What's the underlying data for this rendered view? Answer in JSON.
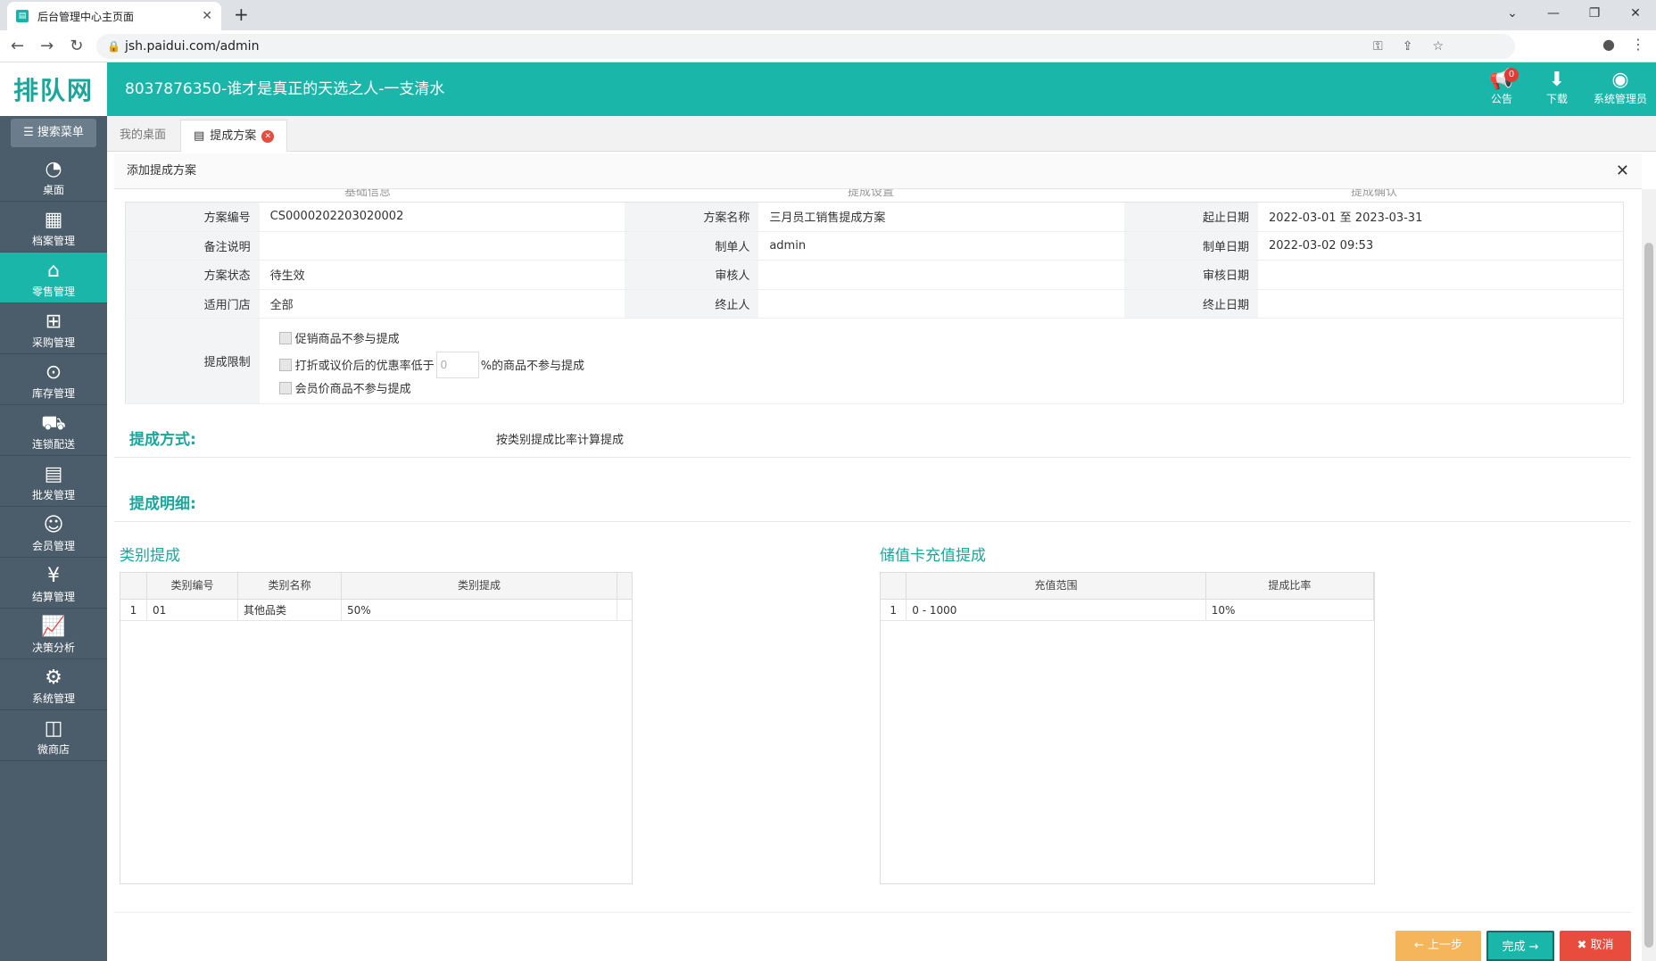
{
  "browser": {
    "tab_title": "后台管理中心主页面",
    "url": "jsh.paidui.com/admin"
  },
  "header": {
    "logo": "排队网",
    "title": "8037876350-谁才是真正的天选之人-一支清水",
    "notice_label": "公告",
    "notice_count": "0",
    "download_label": "下载",
    "user_label": "系统管理员"
  },
  "sidebar": {
    "search_label": "搜索菜单",
    "items": [
      {
        "label": "桌面",
        "icon": "dashboard-icon"
      },
      {
        "label": "档案管理",
        "icon": "archive-icon"
      },
      {
        "label": "零售管理",
        "icon": "store-icon"
      },
      {
        "label": "采购管理",
        "icon": "cart-icon"
      },
      {
        "label": "库存管理",
        "icon": "inventory-icon"
      },
      {
        "label": "连锁配送",
        "icon": "truck-icon"
      },
      {
        "label": "批发管理",
        "icon": "wholesale-icon"
      },
      {
        "label": "会员管理",
        "icon": "member-icon"
      },
      {
        "label": "结算管理",
        "icon": "settle-icon"
      },
      {
        "label": "决策分析",
        "icon": "chart-icon"
      },
      {
        "label": "系统管理",
        "icon": "gear-icon"
      },
      {
        "label": "微商店",
        "icon": "shop-icon"
      }
    ]
  },
  "tabs": {
    "home": "我的桌面",
    "current": "提成方案"
  },
  "dialog": {
    "title": "添加提成方案",
    "steps": [
      "基础信息",
      "提成设置",
      "提成确认"
    ],
    "info": {
      "scheme_no_label": "方案编号",
      "scheme_no": "CS0000202203020002",
      "scheme_name_label": "方案名称",
      "scheme_name": "三月员工销售提成方案",
      "period_label": "起止日期",
      "period": "2022-03-01 至 2023-03-31",
      "remark_label": "备注说明",
      "remark": "",
      "creator_label": "制单人",
      "creator": "admin",
      "create_date_label": "制单日期",
      "create_date": "2022-03-02 09:53",
      "status_label": "方案状态",
      "status": "待生效",
      "auditor_label": "审核人",
      "auditor": "",
      "audit_date_label": "审核日期",
      "audit_date": "",
      "store_label": "适用门店",
      "store": "全部",
      "terminator_label": "终止人",
      "terminator": "",
      "end_date_label": "终止日期",
      "end_date": "",
      "limit_label": "提成限制",
      "limit_opt1": "促销商品不参与提成",
      "limit_opt2_prefix": "打折或议价后的优惠率低于",
      "limit_opt2_value": "0",
      "limit_opt2_suffix": "%的商品不参与提成",
      "limit_opt3": "会员价商品不参与提成"
    },
    "method_title": "提成方式:",
    "method_value": "按类别提成比率计算提成",
    "detail_title": "提成明细:",
    "category_grid": {
      "title": "类别提成",
      "headers": [
        "类别编号",
        "类别名称",
        "类别提成"
      ],
      "rows": [
        {
          "no": "1",
          "code": "01",
          "name": "其他品类",
          "rate": "50%"
        }
      ]
    },
    "card_grid": {
      "title": "储值卡充值提成",
      "headers": [
        "充值范围",
        "提成比率"
      ],
      "rows": [
        {
          "no": "1",
          "range": "0 - 1000",
          "rate": "10%"
        }
      ]
    },
    "buttons": {
      "prev": "上一步",
      "done": "完成",
      "cancel": "取消"
    }
  }
}
